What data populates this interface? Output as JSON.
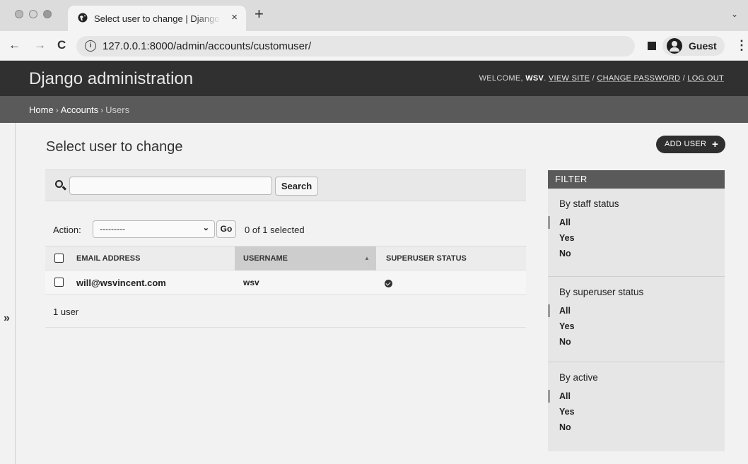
{
  "browser": {
    "tab_title": "Select user to change | Django site admin",
    "tab_close": "×",
    "new_tab": "+",
    "tab_list": "⌄",
    "back": "←",
    "forward": "→",
    "reload": "C",
    "info": "i",
    "url": "127.0.0.1:8000/admin/accounts/customuser/",
    "profile_label": "Guest",
    "menu": "⋮"
  },
  "header": {
    "branding": "Django administration",
    "welcome": "WELCOME,",
    "username": "WSV",
    "view_site": "VIEW SITE",
    "sep1": " / ",
    "change_password": "CHANGE PASSWORD",
    "sep2": " / ",
    "log_out": "LOG OUT"
  },
  "breadcrumbs": {
    "home": "Home",
    "accounts": "Accounts",
    "current": "Users",
    "sep": "›"
  },
  "nav_toggle": "»",
  "content": {
    "title": "Select user to change",
    "add_user": "ADD USER",
    "add_plus": "+"
  },
  "search": {
    "value": "",
    "button": "Search"
  },
  "actions": {
    "label": "Action:",
    "selected": "---------",
    "chevron": "⌄",
    "go": "Go",
    "counter": "0 of 1 selected"
  },
  "table": {
    "headers": [
      "EMAIL ADDRESS",
      "USERNAME",
      "SUPERUSER STATUS"
    ],
    "sort_arrow": "▲",
    "rows": [
      {
        "email": "will@wsvincent.com",
        "username": "wsv",
        "superuser": true
      }
    ],
    "paginator": "1 user"
  },
  "filter": {
    "title": "FILTER",
    "groups": [
      {
        "title": "By staff status",
        "options": [
          "All",
          "Yes",
          "No"
        ]
      },
      {
        "title": "By superuser status",
        "options": [
          "All",
          "Yes",
          "No"
        ]
      },
      {
        "title": "By active",
        "options": [
          "All",
          "Yes",
          "No"
        ]
      }
    ]
  }
}
